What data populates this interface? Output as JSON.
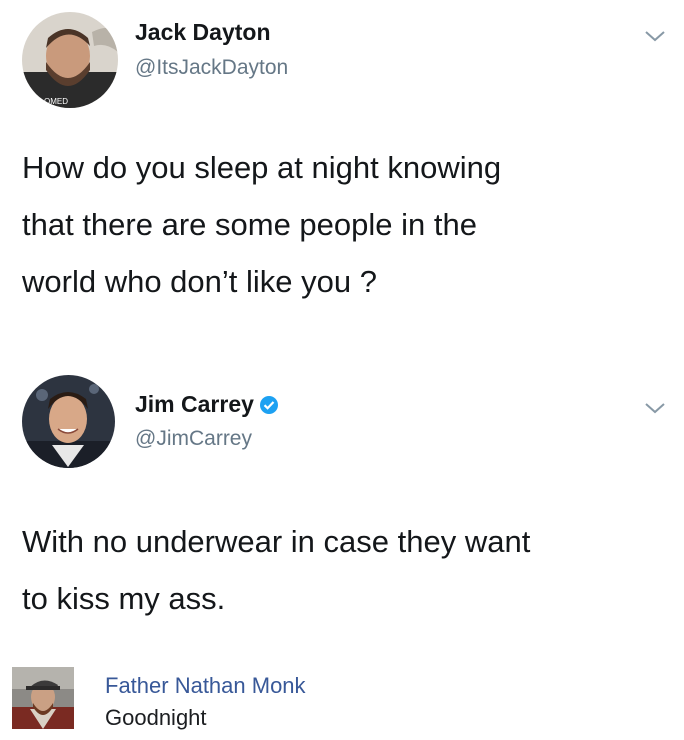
{
  "tweets": [
    {
      "name": "Jack Dayton",
      "handle": "@ItsJackDayton",
      "verified": false,
      "text_lines": [
        "How do you sleep at night knowing",
        "that there are some people in the",
        "world who don’t like you ?"
      ]
    },
    {
      "name": "Jim Carrey",
      "handle": "@JimCarrey",
      "verified": true,
      "text_lines": [
        "With no underwear in case they want",
        "to kiss my ass."
      ]
    }
  ],
  "comment": {
    "author": "Father Nathan Monk",
    "text": "Goodnight"
  },
  "icons": {
    "chevron": "chevron-down-icon",
    "verified": "verified-badge-icon"
  },
  "colors": {
    "text": "#14171a",
    "handle": "#657786",
    "verified": "#1da1f2",
    "fb_link": "#385898"
  }
}
